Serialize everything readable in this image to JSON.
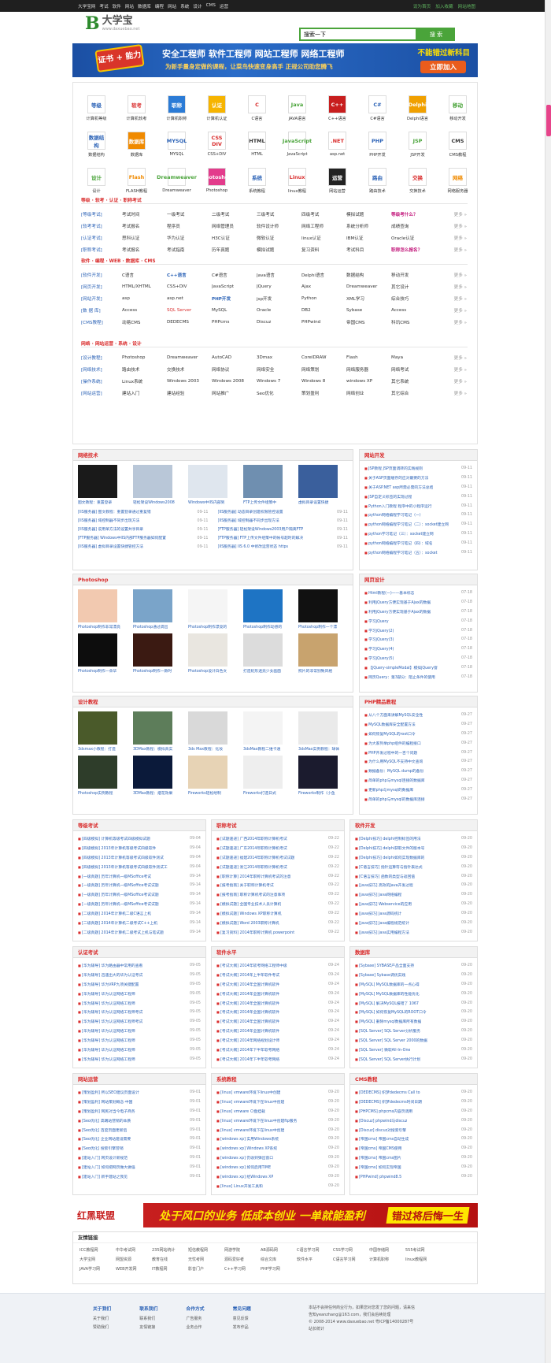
{
  "topbar": {
    "nav": [
      "大学宝网",
      "考试",
      "软件",
      "网站",
      "数据库",
      "编程",
      "网站",
      "系统",
      "设计",
      "CMS",
      "运营"
    ],
    "right": [
      "设为首页",
      "加入收藏",
      "网站地图"
    ]
  },
  "logo": {
    "mark": "B",
    "name": "大学宝",
    "url": "www.daxuebao.net"
  },
  "search": {
    "value": "搜索一下",
    "button": "搜 索"
  },
  "banner": {
    "tag": "证书 + 能力",
    "line1": "安全工程师 软件工程师 网站工程师 网络工程师",
    "line2": "为新手量身定做的课程，让菜鸟快速变身高手 正规公司助您腾飞",
    "right1": "不能错过新科目",
    "right2": "立即加入"
  },
  "icons": [
    {
      "k": "等级",
      "l": "计算机等级",
      "bg": "#ffffff",
      "fg": "#2b62b6"
    },
    {
      "k": "软考",
      "l": "计算机软考",
      "bg": "#ffffff",
      "fg": "#d92c2c"
    },
    {
      "k": "职称",
      "l": "计算机职称",
      "bg": "#2b7bd6",
      "fg": "#ffffff"
    },
    {
      "k": "认证",
      "l": "计算机认证",
      "bg": "#f6b400",
      "fg": "#ffffff"
    },
    {
      "k": "C",
      "l": "C语言",
      "bg": "#ffffff",
      "fg": "#d92c2c"
    },
    {
      "k": "Java",
      "l": "JAVA语言",
      "bg": "#ffffff",
      "fg": "#4aa43a"
    },
    {
      "k": "C++",
      "l": "C++语言",
      "bg": "#c81e1e",
      "fg": "#ffffff"
    },
    {
      "k": "C#",
      "l": "C#语言",
      "bg": "#ffffff",
      "fg": "#2b62b6"
    },
    {
      "k": "Delphi",
      "l": "Delphi语言",
      "bg": "#f0a000",
      "fg": "#ffffff"
    },
    {
      "k": "移动",
      "l": "移动开发",
      "bg": "#ffffff",
      "fg": "#4aa43a"
    },
    {
      "k": "数据结构",
      "l": "数据结构",
      "bg": "#ffffff",
      "fg": "#2b62b6"
    },
    {
      "k": "数据库",
      "l": "数据库",
      "bg": "#f08a00",
      "fg": "#ffffff"
    },
    {
      "k": "MYSQL",
      "l": "MYSQL",
      "bg": "#ffffff",
      "fg": "#2b62b6"
    },
    {
      "k": "CSS DIV",
      "l": "CSS+DIV",
      "bg": "#ffffff",
      "fg": "#d92c2c"
    },
    {
      "k": "HTML",
      "l": "HTML",
      "bg": "#ffffff",
      "fg": "#333333"
    },
    {
      "k": "JavaScript",
      "l": "JavaScript",
      "bg": "#ffffff",
      "fg": "#4aa43a"
    },
    {
      "k": ".NET",
      "l": "asp.net",
      "bg": "#ffffff",
      "fg": "#d92c2c"
    },
    {
      "k": "PHP",
      "l": "PHP开发",
      "bg": "#ffffff",
      "fg": "#2b62b6"
    },
    {
      "k": "JSP",
      "l": "JSP开发",
      "bg": "#ffffff",
      "fg": "#4aa43a"
    },
    {
      "k": "CMS",
      "l": "CMS教程",
      "bg": "#ffffff",
      "fg": "#333333"
    },
    {
      "k": "设计",
      "l": "设计",
      "bg": "#ffffff",
      "fg": "#4aa43a"
    },
    {
      "k": "Flash",
      "l": "FLASH教程",
      "bg": "#ffffff",
      "fg": "#f08a00"
    },
    {
      "k": "Dreamweaver",
      "l": "Dreamweaver",
      "bg": "#ffffff",
      "fg": "#4aa43a"
    },
    {
      "k": "Photoshop",
      "l": "Photoshop",
      "bg": "#e33c8c",
      "fg": "#ffffff"
    },
    {
      "k": "系统",
      "l": "系统教程",
      "bg": "#ffffff",
      "fg": "#2b62b6"
    },
    {
      "k": "Linux",
      "l": "linux教程",
      "bg": "#ffffff",
      "fg": "#d92c2c"
    },
    {
      "k": "运营",
      "l": "网站运营",
      "bg": "#222222",
      "fg": "#ffffff"
    },
    {
      "k": "路由",
      "l": "路由技术",
      "bg": "#ffffff",
      "fg": "#2b62b6"
    },
    {
      "k": "交换",
      "l": "交换技术",
      "bg": "#ffffff",
      "fg": "#d92c2c"
    },
    {
      "k": "网络",
      "l": "网络服务器",
      "bg": "#ffffff",
      "fg": "#f08a00"
    }
  ],
  "sections": [
    {
      "title": "等级 · 软考 · 认证 · 职称考试",
      "rows": [
        [
          "[等级考试]",
          "考试时间",
          "一级考试",
          "二级考试",
          "三级考试",
          "四级考试",
          "模拟试题",
          "等级考什么？",
          "更多 »"
        ],
        [
          "[软考考试]",
          "考试报名",
          "程序员",
          "网络管理员",
          "软件设计师",
          "网络工程师",
          "系统分析师",
          "成绩查询",
          "更多 »"
        ],
        [
          "[认证考试]",
          "思科认证",
          "华为认证",
          "H3C认证",
          "微软认证",
          "linux认证",
          "IBM认证",
          "Oracle认证",
          "更多 »"
        ],
        [
          "[职称考试]",
          "考试报名",
          "考试指南",
          "历年真题",
          "模拟试题",
          "复习资料",
          "考试科目",
          "职称怎么报名？",
          "更多 »"
        ]
      ]
    },
    {
      "title": "软件 · 编程 · WEB · 数据库 · CMS",
      "rows": [
        [
          "[软件开发]",
          "C语言",
          "C++语言",
          "C#语言",
          "Java语言",
          "Delphi语言",
          "数据结构",
          "移动开发",
          "更多 »"
        ],
        [
          "[网页开发]",
          "HTML/XHTML",
          "CSS+DIV",
          "JavaScript",
          "JQuery",
          "Ajax",
          "Dreamweaver",
          "其它设计",
          "更多 »"
        ],
        [
          "[网站开发]",
          "asp",
          "asp.net",
          "PHP开发",
          "jsp开发",
          "Python",
          "XML学习",
          "综合技巧",
          "更多 »"
        ],
        [
          "[数 据 库]",
          "Access",
          "SQL Server",
          "MySQL",
          "Oracle",
          "DB2",
          "Sybase",
          "Access",
          "更多 »"
        ],
        [
          "[CMS教程]",
          "动易CMS",
          "DEDECMS",
          "PHPcms",
          "Discuz",
          "PHPwind",
          "帝国CMS",
          "科讯CMS",
          "更多 »"
        ]
      ]
    },
    {
      "title": "网络 · 网站运营 · 系统 · 设计",
      "rows": [
        [
          "[设计教程]",
          "Photoshop",
          "Dreamweaver",
          "AutoCAD",
          "3Dmax",
          "CorelDRAW",
          "Flash",
          "Maya",
          "更多 »"
        ],
        [
          "[网络技术]",
          "路由技术",
          "交换技术",
          "网络协议",
          "网络安全",
          "网络策划",
          "网络服务器",
          "网络考试",
          "更多 »"
        ],
        [
          "[操作系统]",
          "Linux系统",
          "Windows 2003",
          "Windows 2008",
          "Windows 7",
          "Windows 8",
          "windows XP",
          "其它系统",
          "更多 »"
        ],
        [
          "[网站运营]",
          "建站入门",
          "建站经验",
          "网站推广",
          "Seo优化",
          "策划盈利",
          "网络创业",
          "其它综合",
          "更多 »"
        ]
      ]
    }
  ],
  "net_tech": {
    "title": "网络技术",
    "thumbs": [
      "图文教程：重置登录",
      "轻松架设Windows2008",
      "Windows中IIS内部到",
      "FTP上传文件组策中",
      "虚拟目录设置快捷"
    ],
    "list": [
      [
        "[IIS服务器] 图文教程：重置登录通过重复错",
        "09-11"
      ],
      [
        "[IIS服务器] 动态目录创建权限管控设置",
        "09-11"
      ],
      [
        "[IIS服务器] 域控制器不同步出现方法",
        "09-11"
      ],
      [
        "[IIS服务器] 域控制器不同步出现方法",
        "09-11"
      ],
      [
        "[IIS服务器] 说用单方法的设置共享目录",
        "09-11"
      ],
      [
        "[FTP服务器] 轻松架设Windows2003用户隔离FTP",
        "09-11"
      ],
      [
        "[FTP服务器] Windows中IIS内部FTP服务器如何配置",
        "09-11"
      ],
      [
        "[FTP服务器] FTP上传文件组策中的帐号超时的解决",
        "09-11"
      ],
      [
        "[IIS服务器] 虚拟目录设置快捷管控方法",
        "09-11"
      ],
      [
        "[IIS服务器] IIS 6.0 中修改运营状态 https",
        "09-11"
      ]
    ]
  },
  "web_dev": {
    "title": "网站开发",
    "list": [
      [
        "JSP教程 JSP页面调转的实践规则",
        "09-11"
      ],
      [
        "关于ASP页面缓存的应对最要的方法",
        "09-11"
      ],
      [
        "关于ASP.NET asp所需必需的方法总结",
        "09-11"
      ],
      [
        "JSP自定义标签的实现过程",
        "09-11"
      ],
      [
        "Python入门教程 程序中的小程序运行",
        "09-11"
      ],
      [
        "python网络编程学习笔记（一）",
        "09-11"
      ],
      [
        "python网络编程学习笔记（二）：socket建立网",
        "09-11"
      ],
      [
        "python学习笔记（三）：socket建立网",
        "09-11"
      ],
      [
        "python网络编程学习笔记（四）：域名",
        "09-11"
      ],
      [
        "python网络编程学习笔记（五）：socket",
        "09-11"
      ]
    ]
  },
  "photoshop": {
    "title": "Photoshop",
    "thumbs": [
      "Photoshop制作非常漂亮",
      "Photoshop通过调出",
      "Photoshop制作漂亮的",
      "Photoshop制作动感的",
      "Photoshop制作一个漂",
      "Photoshop制作一朵华",
      "Photoshop制作一款时",
      "Photoshop设计白色文",
      "打造蛇形透亮少女画面",
      "照片的非常别致风格"
    ]
  },
  "web_design": {
    "title": "网页设计",
    "list": [
      [
        "Html教程(一)——基本标志",
        "07-18"
      ],
      [
        "利用jQuery方便实现基于Ajax的数据",
        "07-18"
      ],
      [
        "利用jQuery方便实现基于Ajax的数据",
        "07-18"
      ],
      [
        "学习jQuery",
        "07-18"
      ],
      [
        "学习jQuery(2)",
        "07-18"
      ],
      [
        "学习jQuery(3)",
        "07-18"
      ],
      [
        "学习jQuery(4)",
        "07-18"
      ],
      [
        "学习jQuery(5)",
        "07-18"
      ],
      [
        "【jQuery-simpleModal】模拟jQuery窗",
        "07-18"
      ],
      [
        "网页Query：第3部分：阻止条件的使用",
        "07-18"
      ]
    ]
  },
  "design": {
    "title": "设计教程",
    "thumbs": [
      "3dsmax小教程：打造",
      "3DMax教程：模拟真实",
      "3ds Max教程：化妆",
      "3dsMax教程二维卡通",
      "3dsMax实例教程：球体",
      "Photoshop实例教程",
      "3DMax教程：烟花效果",
      "Fireworks轻松绘制",
      "Fireworks打造日式",
      "Fireworks制作（小鱼"
    ]
  },
  "php": {
    "title": "PHP精品教程",
    "list": [
      [
        "从八个方面来讲解MySQL安全性",
        "09-27"
      ],
      [
        "MySQL数据库安全配置方法",
        "09-27"
      ],
      [
        "如何恢复MySQL的root口令",
        "09-27"
      ],
      [
        "为大家列举php组件的编程接口",
        "09-27"
      ],
      [
        "PHP开发过程中的一百个问题",
        "09-27"
      ],
      [
        "为什么用MySQL不支持中文查询",
        "09-27"
      ],
      [
        "数据备份：MySQL dump的备份",
        "09-27"
      ],
      [
        "简单的php与mysql连接的数据库",
        "09-27"
      ],
      [
        "更新php与mysql的数据库",
        "09-27"
      ],
      [
        "简单的php与mysql的数据库连接",
        "09-27"
      ]
    ]
  },
  "grade": {
    "title": "等级考试",
    "list": [
      [
        "[四级模拟] 计算机等级考试四级模拟试题",
        "09-04"
      ],
      [
        "[四级模拟] 2013年计算机等级考试四级软件",
        "09-04"
      ],
      [
        "[四级模拟] 2013年计算机等级考试四级软件测试",
        "09-04"
      ],
      [
        "[四级模拟] 2013年计算机等级考试四级软件测试工",
        "09-04"
      ],
      [
        "[一级真题] 历年计算机一级MSoffice考试",
        "09-14"
      ],
      [
        "[一级真题] 历年计算机一级MSoffice考试试题",
        "09-14"
      ],
      [
        "[一级真题] 历年计算机一级MSoffice考试试题",
        "09-14"
      ],
      [
        "[一级真题] 历年计算机一级MSoffice考试试题",
        "09-14"
      ],
      [
        "[二级真题] 2014年计算机二级C语言上机",
        "09-14"
      ],
      [
        "[二级真题] 2014年计算机二级考试C++上机",
        "09-14"
      ],
      [
        "[二级真题] 2014年计算机二级考试上机与笔试题",
        "09-14"
      ]
    ]
  },
  "title_exam": {
    "title": "职称考试",
    "list": [
      [
        "[试题速递] 广西2014年职称计算机考试",
        "09-22"
      ],
      [
        "[试题速递] 广东2014年职称计算机考试",
        "09-22"
      ],
      [
        "[试题速递] 福建2014年职称计算机考试试题",
        "09-22"
      ],
      [
        "[试题速递] 浙江2014年职称计算机考试",
        "09-22"
      ],
      [
        "[职称计算] 2014年职称计算机考试的注意",
        "09-22"
      ],
      [
        "[报考指南] 关于职称计算机考试",
        "09-22"
      ],
      [
        "[报考指南] 职称计算机考试的注意事项",
        "09-22"
      ],
      [
        "[模拟试题] 全国专业技术人员计算机",
        "09-22"
      ],
      [
        "[模拟试题] Windows XP职称计算机",
        "09-22"
      ],
      [
        "[模拟试题] Word 2003职称计算机",
        "09-22"
      ],
      [
        "[复习资料] 2014年职称计算机 powerpoint",
        "09-22"
      ]
    ]
  },
  "soft_dev": {
    "title": "软件开发",
    "list": [
      [
        "[Delphi技巧] delphi控制标签的用法",
        "09-20"
      ],
      [
        "[Delphi技巧] delphi获取文件的版本号",
        "09-20"
      ],
      [
        "[Delphi技巧] delphi如何实现数据库的",
        "09-20"
      ],
      [
        "[C语言技巧] 指针运算符与指针表达式",
        "09-20"
      ],
      [
        "[C语言技巧] 函数的类型与返回值",
        "09-20"
      ],
      [
        "[java技巧] 高效的Java开发过程",
        "09-20"
      ],
      [
        "[java技巧] Java网络编程",
        "09-20"
      ],
      [
        "[java技巧] Webservice的应用",
        "09-20"
      ],
      [
        "[java技巧] Java源码统计",
        "09-20"
      ],
      [
        "[java技巧] Java编程规范统计",
        "09-20"
      ],
      [
        "[java技巧] Java实用编程方法",
        "09-20"
      ]
    ]
  },
  "cert": {
    "title": "认证考试",
    "list": [
      [
        "[华为辅导] 华为路由器中常用的查看",
        "09-05"
      ],
      [
        "[华为辅导] 迅速出大的华为认证考试",
        "09-05"
      ],
      [
        "[华为辅导] 华为VRP九项关键配置",
        "09-05"
      ],
      [
        "[华为辅导] 华为认证网络工程师",
        "09-05"
      ],
      [
        "[华为辅导] 华为认证网络工程师",
        "09-05"
      ],
      [
        "[华为辅导] 华为认证网络工程师考试",
        "09-05"
      ],
      [
        "[华为辅导] 华为认证网络工程师考试",
        "09-05"
      ],
      [
        "[华为辅导] 华为认证网络工程师",
        "09-05"
      ],
      [
        "[华为辅导] 华为认证网络工程师",
        "09-05"
      ],
      [
        "[华为辅导] 华为认证网络工程师",
        "09-05"
      ],
      [
        "[华为辅导] 华为认证网络工程师",
        "09-05"
      ]
    ]
  },
  "soft_level": {
    "title": "软件水平",
    "list": [
      [
        "[考试大纲] 2014年软考网络工程师中级",
        "09-24"
      ],
      [
        "[考试大纲] 2014年上半年软件考试",
        "09-24"
      ],
      [
        "[考试大纲] 2014年全国计算机软件",
        "09-24"
      ],
      [
        "[考试大纲] 2014年全国计算机软件",
        "09-24"
      ],
      [
        "[考试大纲] 2014年全国计算机软件",
        "09-24"
      ],
      [
        "[考试大纲] 2014年全国计算机软件",
        "09-24"
      ],
      [
        "[考试大纲] 2014年全国计算机软件",
        "09-24"
      ],
      [
        "[考试大纲] 2014年全国计算机软件",
        "09-24"
      ],
      [
        "[考试大纲] 2014年网络规划设计师",
        "09-24"
      ],
      [
        "[考试大纲] 2014年下半年软考网络",
        "09-24"
      ],
      [
        "[考试大纲] 2014年下半年软考网络",
        "09-24"
      ]
    ]
  },
  "database": {
    "title": "数据库",
    "list": [
      [
        "[Sybase] SYBASE产品全面支持",
        "09-20"
      ],
      [
        "[Sybase] Sybase调优实践",
        "09-20"
      ],
      [
        "[MySQL] MySQL数据库的一点心得",
        "09-20"
      ],
      [
        "[MySQL] MySQL数据库的性能优化",
        "09-20"
      ],
      [
        "[MySQL] 解决MySQL报错了 1067",
        "09-20"
      ],
      [
        "[MySQL] 如何恢复MySQL的ROOT口令",
        "09-20"
      ],
      [
        "[MySQL] 删除mysql数据库所有数据",
        "09-20"
      ],
      [
        "[SQL Server] SQL Server分析服务",
        "09-20"
      ],
      [
        "[SQL Server] SQL Server 2000的数据",
        "09-20"
      ],
      [
        "[SQL Server] 微软All-In-One",
        "09-20"
      ],
      [
        "[SQL Server] SQL Server执行计划",
        "09-20"
      ]
    ]
  },
  "web_ops": {
    "title": "网站运营",
    "list": [
      [
        "[策划盈利] 所以SEO建议页面设计",
        "09-01"
      ],
      [
        "[策划盈利] 网站策划概念·中国",
        "09-01"
      ],
      [
        "[策划盈利] 网民对当今电子商务",
        "09-01"
      ],
      [
        "[Seo优化] 高端站营销的本质",
        "09-01"
      ],
      [
        "[Seo优化] 百度页面更新后",
        "09-01"
      ],
      [
        "[Seo优化] 企业网站建设需要",
        "09-01"
      ],
      [
        "[Seo优化] 搜索引擎营销",
        "09-01"
      ],
      [
        "[建站入门] 网页设计新规范",
        "09-01"
      ],
      [
        "[建站入门] 如何把网页做大做强",
        "09-01"
      ],
      [
        "[建站入门] 新手建站之我见",
        "09-01"
      ]
    ]
  },
  "sys": {
    "title": "系统教程",
    "list": [
      [
        "[linux] vmware环境下linux中创建",
        "09-20"
      ],
      [
        "[linux] vmware环境下在linux中创建",
        "09-20"
      ],
      [
        "[linux] vmware Ｏ盘挂载",
        "09-20"
      ],
      [
        "[linux] vmware环境下在linux中创建ftp服务",
        "09-20"
      ],
      [
        "[linux] vmware环境下在linux中创建",
        "09-20"
      ],
      [
        "[windows xp] 实用Windows系统",
        "09-20"
      ],
      [
        "[windows xp] Windows XP系统",
        "09-20"
      ],
      [
        "[windows xp] 仍收到弹出窗口",
        "09-20"
      ],
      [
        "[windows xp] 如何启用TIME",
        "09-20"
      ],
      [
        "[windows xp] 给Windows XP",
        "09-20"
      ],
      [
        "[linux] Linux开发工具和",
        "09-20"
      ]
    ]
  },
  "cms": {
    "title": "CMS教程",
    "list": [
      [
        "[DEDECMS] 织梦dedecms Call to",
        "09-20"
      ],
      [
        "[DEDECMS] 织梦dedecms时间日期",
        "09-20"
      ],
      [
        "[PHPCMS] phpcms内容页调用",
        "09-20"
      ],
      [
        "[Discuz] phpwind与discuz",
        "09-20"
      ],
      [
        "[Discuz] discuz对搜索引擎",
        "09-20"
      ],
      [
        "[帝国cms] 帝国cms自动生成",
        "09-20"
      ],
      [
        "[帝国cms] 帝国CMS使用",
        "09-20"
      ],
      [
        "[帝国cms] 帝国cms图片",
        "09-20"
      ],
      [
        "[帝国cms] 如何实现帝国",
        "09-20"
      ],
      [
        "[PHPwind] phpwind8.5",
        "09-20"
      ]
    ]
  },
  "ad": {
    "logo": "红黑联盟",
    "s1": "处于风口的业务  低成本创业  一单就能盈利",
    "s2": "错过将后悔一生"
  },
  "links": {
    "title": "友情链接",
    "items": [
      "ICC教程网",
      "中华考试网",
      "235网站统计",
      "短信教程网",
      "网游学院",
      "AB源码网",
      "C语言学习网",
      "CSS学习网",
      "中国存储网",
      "555考试网",
      "大学宝网",
      "网盟资源",
      "教育在线",
      "无忧考网",
      "源码爱好者",
      "综合文库",
      "软件水平",
      "C语言学习网",
      "计算机职称",
      "linux教程网",
      "JAVA学习网",
      "WEB开发网",
      "IT教程网",
      "影音门户",
      "C++学习网",
      "PHP学习网"
    ]
  },
  "footer": {
    "cols": [
      {
        "h": "关于我们",
        "i": [
          "关于我们",
          "赞助我们"
        ]
      },
      {
        "h": "联系我们",
        "i": [
          "联系我们",
          "友情链接"
        ]
      },
      {
        "h": "合作方式",
        "i": [
          "广告服务",
          "业务合作"
        ]
      },
      {
        "h": "常见问题",
        "i": [
          "意见反馈",
          "发布作品"
        ]
      }
    ],
    "copy": [
      "本站不会持任何商业行为，如果您对您发了您的问题，请来信",
      "告知yeanzhang@163.com，我们会后续处理",
      "© 2008-2014 www.daxuebao.net 粤ICP备14000287号",
      "站长统计"
    ]
  }
}
